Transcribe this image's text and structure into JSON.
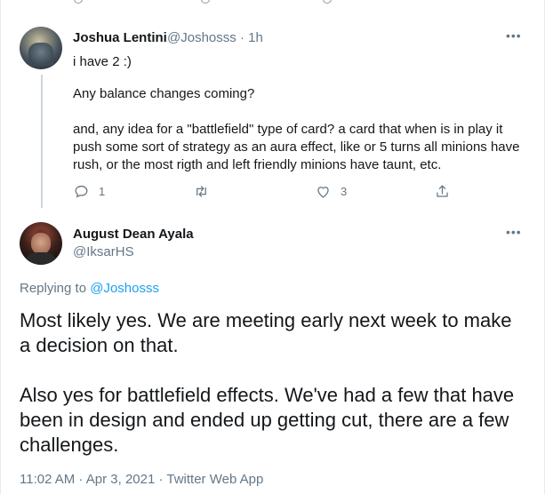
{
  "reply_tweet": {
    "author_name": "Joshua Lentini",
    "author_handle": "@Joshosss",
    "time": "· 1h",
    "more": "•••",
    "line1": "i have 2 :)",
    "line2": "Any balance changes coming?",
    "line3": "and, any idea for a \"battlefield\" type of card? a card that when is in play it push some sort of strategy as an aura effect, like or 5 turns all minions have rush, or the most rigth and left friendly minions have taunt, etc.",
    "actions": {
      "reply_count": "1",
      "retweet_count": "",
      "like_count": "3",
      "icons": [
        "reply-icon",
        "retweet-icon",
        "like-icon",
        "share-icon"
      ]
    }
  },
  "main_tweet": {
    "author_name": "August Dean Ayala",
    "author_handle": "@IksarHS",
    "more": "•••",
    "replying_prefix": "Replying to",
    "replying_to": "@Joshosss",
    "paragraph1": "Most likely yes. We are meeting early next week to make a decision on that.",
    "paragraph2": "Also yes for battlefield effects. We've had a few that have been in design and ended up getting cut, there are a few challenges.",
    "meta": "11:02 AM · Apr 3, 2021 · Twitter Web App"
  },
  "colors": {
    "text": "#14171a",
    "secondary": "#657786",
    "link": "#1da1f2",
    "line": "#ccd6dd"
  }
}
